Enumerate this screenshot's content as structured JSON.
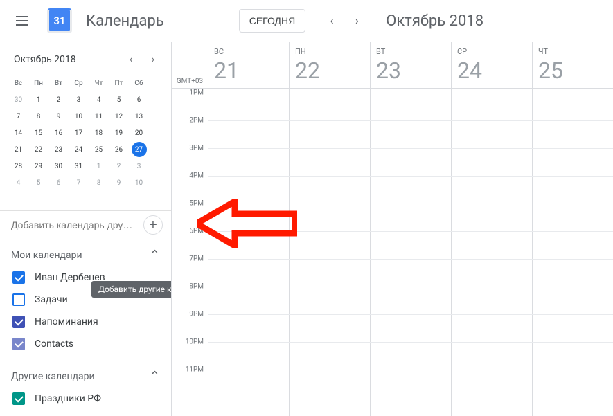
{
  "header": {
    "logo_day": "31",
    "app_title": "Календарь",
    "today_label": "СЕГОДНЯ",
    "current_range": "Октябрь 2018"
  },
  "mini_cal": {
    "title": "Октябрь 2018",
    "dow": [
      "Вс",
      "Пн",
      "Вт",
      "Ср",
      "Чт",
      "Пт",
      "Сб"
    ],
    "weeks": [
      [
        {
          "n": "30",
          "out": true
        },
        {
          "n": "1"
        },
        {
          "n": "2"
        },
        {
          "n": "3"
        },
        {
          "n": "4"
        },
        {
          "n": "5"
        },
        {
          "n": "6"
        }
      ],
      [
        {
          "n": "7"
        },
        {
          "n": "8"
        },
        {
          "n": "9"
        },
        {
          "n": "10"
        },
        {
          "n": "11"
        },
        {
          "n": "12"
        },
        {
          "n": "13"
        }
      ],
      [
        {
          "n": "14"
        },
        {
          "n": "15"
        },
        {
          "n": "16"
        },
        {
          "n": "17"
        },
        {
          "n": "18"
        },
        {
          "n": "19"
        },
        {
          "n": "20"
        }
      ],
      [
        {
          "n": "21"
        },
        {
          "n": "22"
        },
        {
          "n": "23"
        },
        {
          "n": "24"
        },
        {
          "n": "25"
        },
        {
          "n": "26"
        },
        {
          "n": "27",
          "selected": true
        }
      ],
      [
        {
          "n": "28"
        },
        {
          "n": "29"
        },
        {
          "n": "30"
        },
        {
          "n": "31"
        },
        {
          "n": "1",
          "out": true
        },
        {
          "n": "2",
          "out": true
        },
        {
          "n": "3",
          "out": true
        }
      ],
      [
        {
          "n": "4",
          "out": true
        },
        {
          "n": "5",
          "out": true
        },
        {
          "n": "6",
          "out": true
        },
        {
          "n": "7",
          "out": true
        },
        {
          "n": "8",
          "out": true
        },
        {
          "n": "9",
          "out": true
        },
        {
          "n": "10",
          "out": true
        }
      ]
    ]
  },
  "add_cal": {
    "placeholder": "Добавить календарь дру…",
    "tooltip": "Добавить другие календари"
  },
  "my_calendars": {
    "header": "Мои календари",
    "items": [
      {
        "label": "Иван Дербенев",
        "checked": true,
        "color": "#1a73e8"
      },
      {
        "label": "Задачи",
        "checked": false,
        "color": "#1a73e8"
      },
      {
        "label": "Напоминания",
        "checked": true,
        "color": "#3f51b5"
      },
      {
        "label": "Contacts",
        "checked": true,
        "color": "#7986cb"
      }
    ]
  },
  "other_calendars": {
    "header": "Другие календари",
    "items": [
      {
        "label": "Праздники РФ",
        "checked": true,
        "color": "#009688"
      }
    ]
  },
  "week": {
    "timezone": "GMT+03",
    "days": [
      {
        "dow": "Вс",
        "num": "21"
      },
      {
        "dow": "Пн",
        "num": "22"
      },
      {
        "dow": "Вт",
        "num": "23"
      },
      {
        "dow": "Ср",
        "num": "24"
      },
      {
        "dow": "Чт",
        "num": "25"
      }
    ],
    "hours": [
      "1PM",
      "2PM",
      "3PM",
      "4PM",
      "5PM",
      "6PM",
      "7PM",
      "8PM",
      "9PM",
      "10PM",
      "11PM"
    ]
  },
  "colors": {
    "accent": "#1a73e8",
    "arrow": "#ff1a00"
  }
}
